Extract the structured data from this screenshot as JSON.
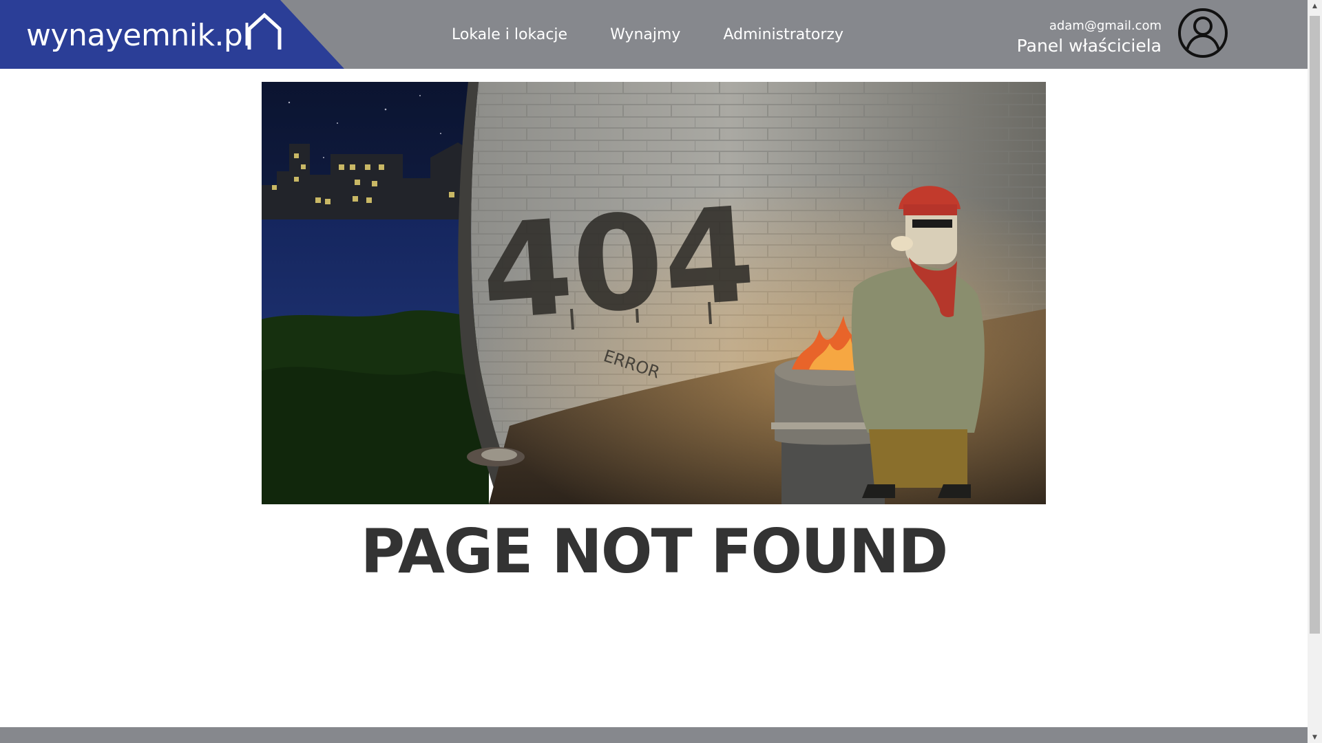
{
  "brand": {
    "logo_text": "wynayemnik.pl"
  },
  "nav": {
    "items": [
      {
        "label": "Lokale i lokacje"
      },
      {
        "label": "Wynajmy"
      },
      {
        "label": "Administratorzy"
      }
    ]
  },
  "account": {
    "email": "adam@gmail.com",
    "panel_label": "Panel właściciela"
  },
  "illustration": {
    "graffiti_text": "404",
    "tag_text": "ERROR"
  },
  "main": {
    "error_title": "PAGE NOT FOUND"
  },
  "colors": {
    "brand_blue": "#2b3e97",
    "header_gray": "#86888d",
    "title_text": "#333333"
  }
}
